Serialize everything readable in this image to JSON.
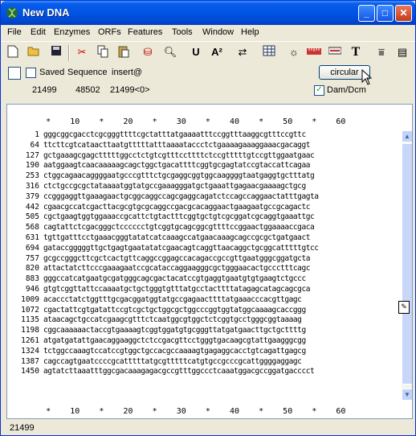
{
  "window": {
    "title": "New DNA"
  },
  "title_buttons": {
    "minimize": "_",
    "maximize": "□",
    "close": "✕"
  },
  "menu": [
    "File",
    "Edit",
    "Enzymes",
    "ORFs",
    "Features",
    "Tools",
    "Window",
    "Help"
  ],
  "toolbar_icons": [
    "new-icon",
    "open-icon",
    "save-icon",
    "cut-icon",
    "copy-icon",
    "paste-icon",
    "print-icon",
    "find-icon",
    "underline-icon",
    "superscript-icon",
    "swap-icon",
    "table-icon",
    "lightbulb-icon",
    "ruler-icon",
    "settings-icon",
    "text-icon",
    "align-icon",
    "graphic-icon"
  ],
  "info": {
    "saved_label": "Saved",
    "sequence_label": "Sequence",
    "insert_label": "insert@",
    "circular_label": "circular",
    "length": "21499",
    "count": "48502",
    "position": "21499<0>",
    "dam_dcm_label": "Dam/Dcm",
    "dam_dcm_checked": true
  },
  "ruler": {
    "text": "        *    10    *    20    *    30    *    40    *    50    *    60"
  },
  "sequence": {
    "rows": [
      {
        "num": "1",
        "seq": "gggcggcgacctcgcgggttttcgctatttatgaaaatttccggtttaaggcgtttccgttc"
      },
      {
        "num": "64",
        "seq": "ttcttcgtcataacttaatgtttttatttaaaataccctctgaaaagaaaggaaacgacaggt"
      },
      {
        "num": "127",
        "seq": "gctgaaagcgagctttttggcctctgtcgtttccttttctccgtttttgtccgttggaatgaac"
      },
      {
        "num": "190",
        "seq": "aatggaagtcaacaaaaagcagctggctgacattttcggtgcgagtatccgtaccattcagaa"
      },
      {
        "num": "253",
        "seq": "ctggcagaacaggggaatgcccgtttctgcgaggcggtggcaaggggtaatgaggtgctttatg"
      },
      {
        "num": "316",
        "seq": "ctctgccgcgctataaaatggtatgccgaaagggatgctgaaattgagaacgaaaagctgcg"
      },
      {
        "num": "379",
        "seq": "ccgggaggttgaaagaactgcggcaggccagcgaggcagatctccagccaggaactatttgagta"
      },
      {
        "num": "442",
        "seq": "cgaacgccatcgacttacgcgtgcgcaggccgacgcacaggaactgaagaatgccgcagactc"
      },
      {
        "num": "505",
        "seq": "cgctgaagtggtggaaaccgcattctgtactttcggtgctgtcgcggatcgcaggtgaaattgc"
      },
      {
        "num": "568",
        "seq": "cagtattctcgacgggctcccccctgtcggtgcagcggcgttttccggaactggaaaaccgaca"
      },
      {
        "num": "631",
        "seq": "tgttgatttcctgaaacgggtatatcatcaaagccatgaacaaagcagccgcgctgatgaact"
      },
      {
        "num": "694",
        "seq": "gataccgggggttgctgagtgaatatatcgaacagtcaggttaacaggctgcggcatttttgtcc"
      },
      {
        "num": "757",
        "seq": "gcgccgggcttcgctcactgttcaggccggagccacagaccgccgttgaatgggcggatgcta"
      },
      {
        "num": "820",
        "seq": "attactatcttcccgaaagaatccgcataccaggaagggcgctgggaacactgccctttcagc"
      },
      {
        "num": "883",
        "seq": "gggccatcatgaatgcgatgggcagcgactacatccgtgaggtgaatgtgtgaagtctgccc"
      },
      {
        "num": "946",
        "seq": "gtgtcggttattccaaaatgctgctgggtgtttatgcctacttttatagagcatagcagcgca"
      },
      {
        "num": "1009",
        "seq": "acaccctatctggtttgcgacggatggtatgccgagaacttttatgaaacccacgttgagc"
      },
      {
        "num": "1072",
        "seq": "cgactattcgtgatattccgtcgctgctggcgctggcccggtggtatggcaaaagcaccggg"
      },
      {
        "num": "1135",
        "seq": "ataacagctgccatcgaagcgtttctcaatggcgtggctctcggtgcctgggcggtaaaag"
      },
      {
        "num": "1198",
        "seq": "cggcaaaaaactaccgtgaaaagtcggtggatgtgcgggttatgatgaacttgctgcttttg"
      },
      {
        "num": "1261",
        "seq": "atgatgatattgaacaggaaggctctccgacgttcctgggtgacaagcgtattgaagggcgg"
      },
      {
        "num": "1324",
        "seq": "tctggccaaagtccatccgtggctgccacgccaaaagtgagaggcacctgtcagattgagcg"
      },
      {
        "num": "1387",
        "seq": "cagccagtgaatccccgcatttttatgcgtttttcatgtgccgcccgcattggggaggagc"
      },
      {
        "num": "1450",
        "seq": "agtatcttaaatttggcgacaaagagacgccgtttggccctcaaatggacgccggatgacccct"
      }
    ]
  },
  "status": {
    "text": "21499"
  }
}
